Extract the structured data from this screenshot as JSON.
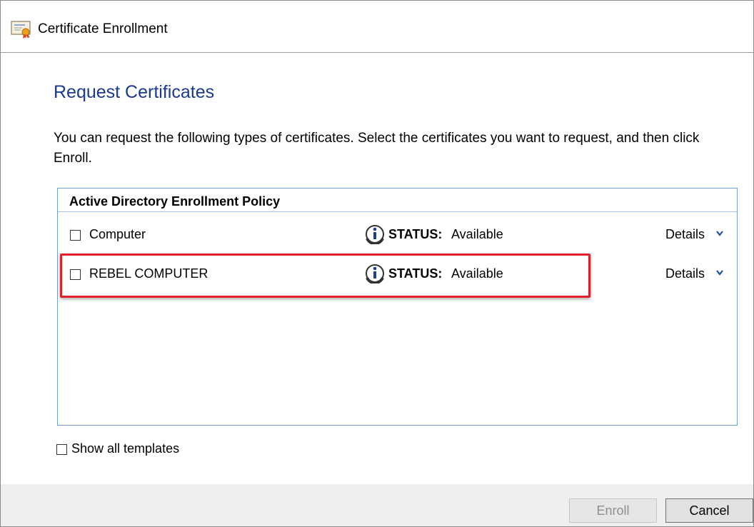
{
  "window": {
    "title": "Certificate Enrollment",
    "icon": "certificate-icon"
  },
  "page": {
    "heading": "Request Certificates",
    "description": "You can request the following types of certificates. Select the certificates you want to request, and then click Enroll."
  },
  "policy": {
    "title": "Active Directory Enrollment Policy",
    "items": [
      {
        "label": "Computer",
        "checked": false,
        "status_key": "STATUS:",
        "status_value": "Available",
        "details_label": "Details",
        "highlighted": false
      },
      {
        "label": "REBEL COMPUTER",
        "checked": false,
        "status_key": "STATUS:",
        "status_value": "Available",
        "details_label": "Details",
        "highlighted": true
      }
    ]
  },
  "options": {
    "show_all_label": "Show all templates",
    "show_all_checked": false
  },
  "buttons": {
    "enroll": "Enroll",
    "enroll_enabled": false,
    "cancel": "Cancel"
  },
  "colors": {
    "heading": "#1a3a8f",
    "listbox_border": "#6f9ed3",
    "highlight": "#e0202a"
  }
}
